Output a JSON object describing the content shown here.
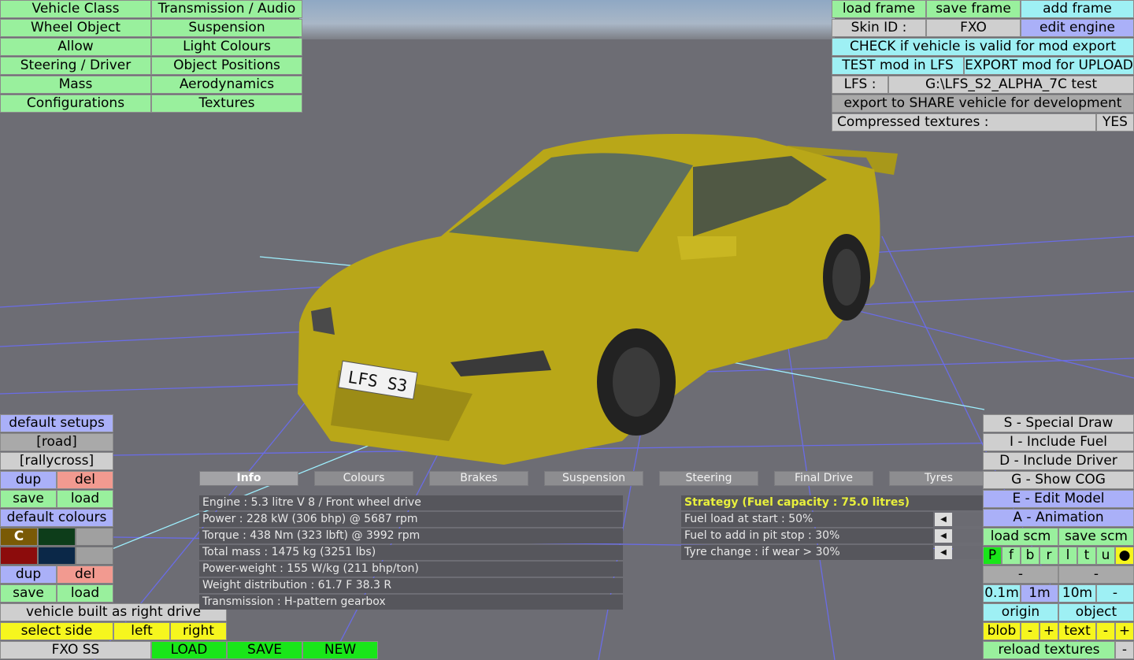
{
  "top_menu": {
    "left_col": [
      "Vehicle Class",
      "Wheel Object",
      "Allow",
      "Steering / Driver",
      "Mass",
      "Configurations"
    ],
    "right_col": [
      "Transmission / Audio",
      "Suspension",
      "Light Colours",
      "Object Positions",
      "Aerodynamics",
      "Textures"
    ]
  },
  "top_right": {
    "load_frame": "load frame",
    "save_frame": "save frame",
    "add_frame": "add frame",
    "skin_id_label": "Skin ID :",
    "skin_id_value": "FXO",
    "edit_engine": "edit engine",
    "check_valid": "CHECK if vehicle is valid for mod export",
    "test_mod": "TEST mod in LFS",
    "export_mod": "EXPORT mod for UPLOAD",
    "lfs_label": "LFS :",
    "lfs_path": "G:\\LFS_S2_ALPHA_7C test",
    "export_share": "export to SHARE vehicle for development",
    "compressed_label": "Compressed textures :",
    "compressed_value": "YES"
  },
  "car": {
    "plate": "LFS S3"
  },
  "left_panel": {
    "default_setups": "default setups",
    "road": "[road]",
    "rallycross": "[rallycross]",
    "dup": "dup",
    "del": "del",
    "save": "save",
    "load": "load",
    "default_colours": "default colours",
    "colour_c": "C",
    "vehicle_built": "vehicle built as right drive",
    "select_side": "select side",
    "left": "left",
    "right": "right"
  },
  "bottom_bar": {
    "name": "FXO SS",
    "load": "LOAD",
    "save": "SAVE",
    "new": "NEW"
  },
  "colors": {
    "swatch_1": "#7a5a06",
    "swatch_2": "#0d3d1a",
    "swatch_3": "#a0a0a0",
    "swatch_4": "#8c0c0c",
    "swatch_5": "#0b2848",
    "swatch_6": "#a0a0a0",
    "car_body": "#b9a718",
    "grid_line": "#6a6ce6"
  },
  "tabs": [
    "Info",
    "Colours",
    "Brakes",
    "Suspension",
    "Steering",
    "Final Drive",
    "Tyres"
  ],
  "info_rows": [
    "Engine : 5.3 litre V 8 / Front wheel drive",
    "Power : 228 kW (306 bhp) @ 5687 rpm",
    "Torque : 438 Nm (323 lbft) @ 3992 rpm",
    "Total mass : 1475 kg (3251 lbs)",
    "Power-weight : 155 W/kg (211 bhp/ton)",
    "Weight distribution : 61.7 F  38.3 R",
    "Transmission : H-pattern gearbox"
  ],
  "strategy": {
    "title": "Strategy (Fuel capacity : 75.0 litres)",
    "rows": [
      "Fuel load at start : 50%",
      "Fuel to add in pit stop : 30%",
      "Tyre change : if wear > 30%"
    ]
  },
  "right_panel": {
    "special_draw": "S - Special Draw",
    "include_fuel": "I - Include Fuel",
    "include_driver": "D - Include Driver",
    "show_cog": "G - Show COG",
    "edit_model": "E - Edit Model",
    "animation": "A - Animation",
    "load_scm": "load scm",
    "save_scm": "save scm",
    "flags": [
      "P",
      "f",
      "b",
      "r",
      "l",
      "t",
      "u",
      "●"
    ],
    "dash": "-",
    "step_01": "0.1m",
    "step_1": "1m",
    "step_10": "10m",
    "origin": "origin",
    "object": "object",
    "blob": "blob",
    "minus": "-",
    "plus": "+",
    "text": "text",
    "reload_textures": "reload textures"
  }
}
